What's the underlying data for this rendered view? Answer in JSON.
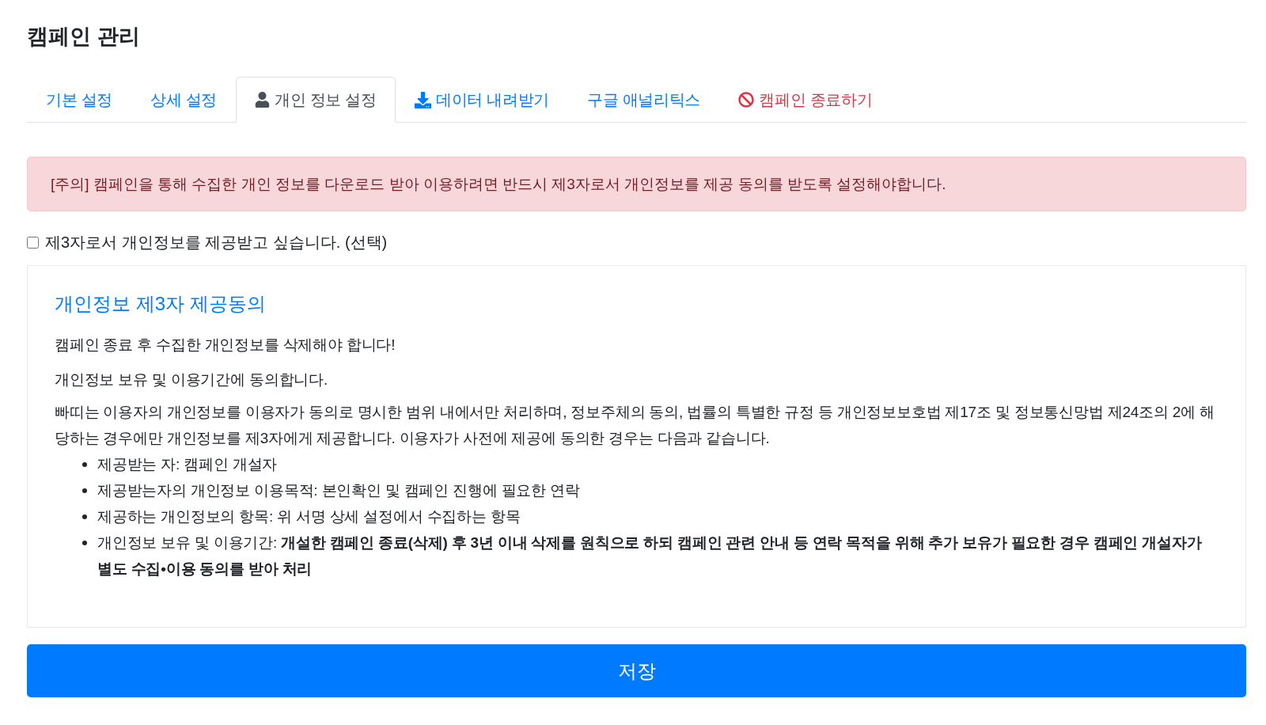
{
  "page_title": "캠페인 관리",
  "tabs": [
    {
      "label": "기본 설정",
      "kind": "plain",
      "selected": false
    },
    {
      "label": "상세 설정",
      "kind": "plain",
      "selected": false
    },
    {
      "label": "개인 정보 설정",
      "kind": "personal",
      "selected": true
    },
    {
      "label": "데이터 내려받기",
      "kind": "download",
      "selected": false
    },
    {
      "label": "구글 애널리틱스",
      "kind": "plain",
      "selected": false
    },
    {
      "label": "캠페인 종료하기",
      "kind": "danger",
      "selected": false
    }
  ],
  "alert": {
    "text": "[주의] 캠페인을 통해 수집한 개인 정보를 다운로드 받아 이용하려면 반드시 제3자로서 개인정보를 제공 동의를 받도록 설정해야합니다."
  },
  "consent_checkbox": {
    "label": "제3자로서 개인정보를 제공받고 싶습니다. (선택)",
    "checked": false
  },
  "consent_panel": {
    "heading": "개인정보 제3자 제공동의",
    "notice": "캠페인 종료 후 수집한 개인정보를 삭제해야 합니다!",
    "subheading": "개인정보 보유 및 이용기간에 동의합니다.",
    "paragraph": "빠띠는 이용자의 개인정보를 이용자가 동의로 명시한 범위 내에서만 처리하며, 정보주체의 동의, 법률의 특별한 규정 등 개인정보보호법 제17조 및 정보통신망법 제24조의 2에 해당하는 경우에만 개인정보를 제3자에게 제공합니다. 이용자가 사전에 제공에 동의한 경우는 다음과 같습니다.",
    "items": [
      "제공받는 자: 캠페인 개설자",
      "제공받는자의 개인정보 이용목적: 본인확인 및 캠페인 진행에 필요한 연락",
      "제공하는 개인정보의 항목: 위 서명 상세 설정에서 수집하는 항목",
      "개인정보 보유 및 이용기간: **개설한 캠페인 종료(삭제) 후 3년 이내 삭제를 원칙으로 하되 캠페인 관련 안내 등 연락 목적을 위해 추가 보유가 필요한 경우 캠페인 개설자가 별도 수집•이용 동의를 받아 처리**"
    ]
  },
  "save_button": {
    "label": "저장"
  }
}
